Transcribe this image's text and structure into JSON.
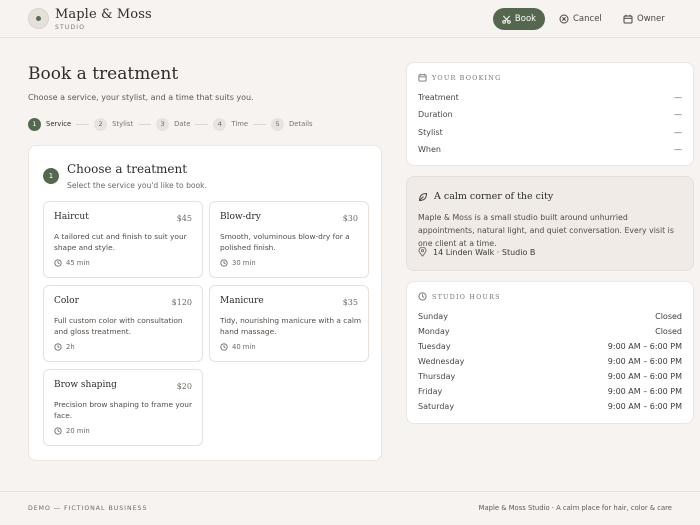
{
  "header": {
    "brand": "Maple & Moss",
    "brand_sub": "STUDIO",
    "book_label": "Book",
    "cancel_label": "Cancel",
    "owner_label": "Owner"
  },
  "page": {
    "title": "Book a treatment",
    "subtitle": "Choose a service, your stylist, and a time that suits you."
  },
  "steps": [
    {
      "num": "1",
      "label": "Service",
      "active": true
    },
    {
      "num": "2",
      "label": "Stylist",
      "active": false
    },
    {
      "num": "3",
      "label": "Date",
      "active": false
    },
    {
      "num": "4",
      "label": "Time",
      "active": false
    },
    {
      "num": "5",
      "label": "Details",
      "active": false
    }
  ],
  "section": {
    "num": "1",
    "title": "Choose a treatment",
    "subtitle": "Select the service you'd like to book."
  },
  "services": [
    {
      "name": "Haircut",
      "price": "$45",
      "desc": "A tailored cut and finish to suit your shape and style.",
      "duration": "45 min"
    },
    {
      "name": "Blow-dry",
      "price": "$30",
      "desc": "Smooth, voluminous blow-dry for a polished finish.",
      "duration": "30 min"
    },
    {
      "name": "Color",
      "price": "$120",
      "desc": "Full custom color with consultation and gloss treatment.",
      "duration": "2h"
    },
    {
      "name": "Manicure",
      "price": "$35",
      "desc": "Tidy, nourishing manicure with a calm hand massage.",
      "duration": "40 min"
    },
    {
      "name": "Brow shaping",
      "price": "$20",
      "desc": "Precision brow shaping to frame your face.",
      "duration": "20 min"
    }
  ],
  "booking": {
    "heading": "YOUR BOOKING",
    "rows": [
      {
        "label": "Treatment",
        "value": "—"
      },
      {
        "label": "Duration",
        "value": "—"
      },
      {
        "label": "Stylist",
        "value": "—"
      },
      {
        "label": "When",
        "value": "—"
      }
    ]
  },
  "about": {
    "title": "A calm corner of the city",
    "text": "Maple & Moss is a small studio built around unhurried appointments, natural light, and quiet conversation. Every visit is one client at a time.",
    "address": "14 Linden Walk · Studio B"
  },
  "hours": {
    "heading": "STUDIO HOURS",
    "rows": [
      {
        "day": "Sunday",
        "time": "Closed"
      },
      {
        "day": "Monday",
        "time": "Closed"
      },
      {
        "day": "Tuesday",
        "time": "9:00 AM – 6:00 PM"
      },
      {
        "day": "Wednesday",
        "time": "9:00 AM – 6:00 PM"
      },
      {
        "day": "Thursday",
        "time": "9:00 AM – 6:00 PM"
      },
      {
        "day": "Friday",
        "time": "9:00 AM – 6:00 PM"
      },
      {
        "day": "Saturday",
        "time": "9:00 AM – 6:00 PM"
      }
    ]
  },
  "footer": {
    "left": "DEMO — FICTIONAL BUSINESS",
    "right": "Maple & Moss Studio · A calm place for hair, color & care"
  },
  "colors": {
    "accent": "#55684f",
    "background": "#f6f3f0"
  }
}
